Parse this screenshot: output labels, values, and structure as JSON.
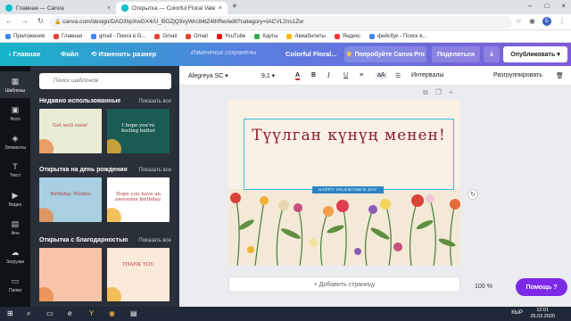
{
  "browser": {
    "tabs": [
      {
        "title": "Главная — Canva",
        "close": "×"
      },
      {
        "title": "Открытка — Colorful Floral Vale",
        "close": "×"
      }
    ],
    "new_tab": "+",
    "window_controls": [
      "–",
      "□",
      "×"
    ],
    "url": "canva.com/design/DAD3hpXwGX4/U_BGZjQ3vyWrc84tZ4thRw/edit?category=tACVL2ns1Zw",
    "avatar_letter": "Б"
  },
  "bookmarks": [
    {
      "label": "Приложения",
      "color": "#4285f4"
    },
    {
      "label": "Главная",
      "color": "#ea4335"
    },
    {
      "label": "gmail - Поиск в G...",
      "color": "#4285f4"
    },
    {
      "label": "Gmail",
      "color": "#ea4335"
    },
    {
      "label": "Gmail",
      "color": "#ea4335"
    },
    {
      "label": "YouTube",
      "color": "#ff0000"
    },
    {
      "label": "Карты",
      "color": "#34a853"
    },
    {
      "label": "Авиабилеты",
      "color": "#fbbc05"
    },
    {
      "label": "Яндекс",
      "color": "#ff3333"
    },
    {
      "label": "фейсбук - Поиск в...",
      "color": "#4285f4"
    }
  ],
  "canva_header": {
    "home": "Главная",
    "file": "Файл",
    "resize": "Изменить размер",
    "save_status": "Изменения сохранены",
    "doc_name": "Colorful Floral...",
    "try_pro": "Попробуйте Canva Pro",
    "share": "Поделиться",
    "publish": "Опубликовать"
  },
  "rail": [
    {
      "label": "Шаблоны",
      "icon": "▦"
    },
    {
      "label": "Фото",
      "icon": "▣"
    },
    {
      "label": "Элементы",
      "icon": "◈"
    },
    {
      "label": "Текст",
      "icon": "T"
    },
    {
      "label": "Видео",
      "icon": "▶"
    },
    {
      "label": "Фон",
      "icon": "▤"
    },
    {
      "label": "Загрузки",
      "icon": "☁"
    },
    {
      "label": "Папки",
      "icon": "▭"
    }
  ],
  "panel": {
    "search_placeholder": "Поиск шаблонов",
    "sections": [
      {
        "title": "Недавно использованные",
        "show_all": "Показать все",
        "cards": [
          {
            "text": "Get well soon!",
            "bg": "#e9ecd4"
          },
          {
            "text": "I hope you're feeling better",
            "bg": "#1a5b53"
          }
        ]
      },
      {
        "title": "Открытка на день рождения",
        "show_all": "Показать все",
        "cards": [
          {
            "text": "Birthday Wishes",
            "bg": "#a9cfe2"
          },
          {
            "text": "Hope you have an awesome birthday.",
            "bg": "#ffffff"
          }
        ]
      },
      {
        "title": "Открытка с благодарностью",
        "show_all": "Показать все",
        "cards": [
          {
            "text": "",
            "bg": "#f7c4a9"
          },
          {
            "text": "THANK YOU",
            "bg": "#fbe9d9"
          }
        ]
      }
    ]
  },
  "toolbar": {
    "font": "Alegreya SC",
    "size": "9,1",
    "spacing": "Интервалы",
    "group": "Разгруппировать"
  },
  "design": {
    "title": "Түүлган күнүң менен!",
    "ribbon": "HAPPY VALENTINE'S DAY"
  },
  "add_page": "+ Добавить страницу",
  "zoom": "100 %",
  "help": "Помощь ?",
  "taskbar": {
    "lang": "КЫР",
    "time": "12:01",
    "date": "25.03.2020"
  },
  "colors": {
    "accent_purple": "#7d2ae8",
    "title_red": "#8b1f2a",
    "selection": "#39c0d8"
  }
}
